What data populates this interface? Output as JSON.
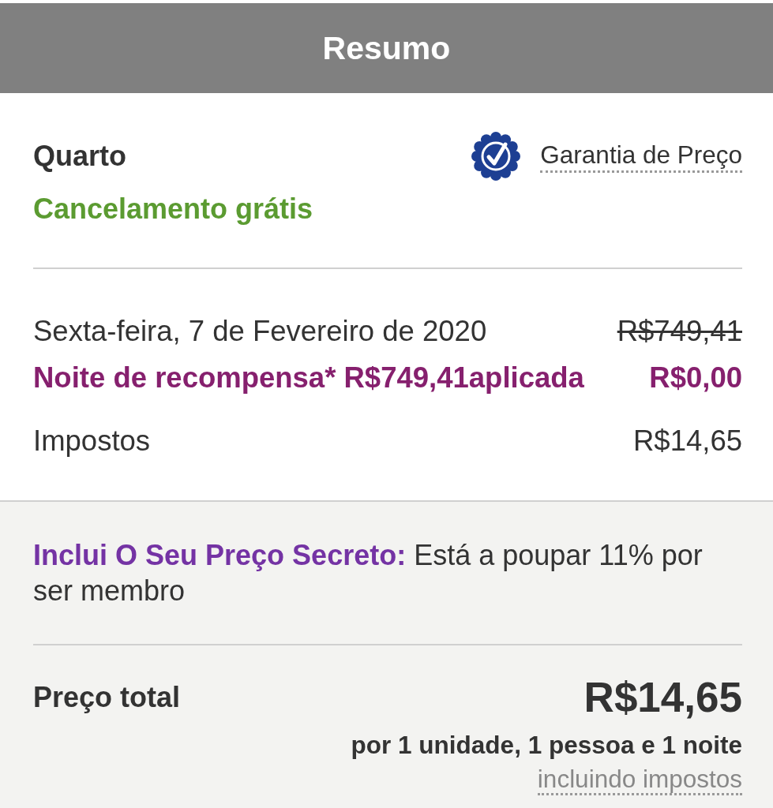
{
  "header": {
    "title": "Resumo"
  },
  "room": {
    "title": "Quarto",
    "cancellation": "Cancelamento grátis",
    "price_guarantee": {
      "label": "Garantia de Preço"
    }
  },
  "lines": [
    {
      "kind": "regular",
      "label": "Sexta-feira, 7 de Fevereiro de 2020",
      "amount": "R$749,41",
      "struck": true
    },
    {
      "kind": "reward",
      "label": "Noite de recompensa* R$749,41aplicada",
      "amount": "R$0,00",
      "struck": false
    },
    {
      "kind": "regular",
      "label": "Impostos",
      "amount": "R$14,65",
      "struck": false
    }
  ],
  "promo": {
    "text": "**Inclui O Seu Preço Secreto:** Está a poupar 11% por ser membro"
  },
  "total": {
    "label": "Preço total",
    "amount": "R$14,65",
    "detail": "por 1 unidade, 1 pessoa e 1 noite",
    "note": "incluindo impostos"
  }
}
